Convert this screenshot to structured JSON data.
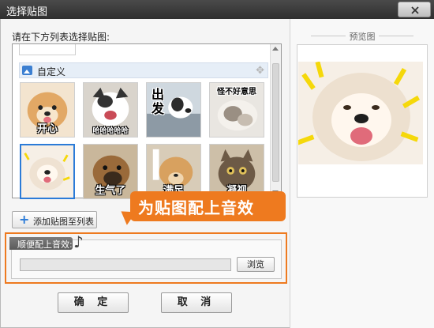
{
  "window": {
    "title": "选择贴图",
    "close_icon": "close-x-icon"
  },
  "left": {
    "choose_label": "请在下方列表选择贴图:",
    "section": {
      "label": "自定义",
      "icon": "picture-icon",
      "move_icon": "move-arrows-icon"
    },
    "stickers": [
      {
        "caption": "开心"
      },
      {
        "caption": "哈哈哈哈哈"
      },
      {
        "caption": "出发"
      },
      {
        "caption": "怪不好意思"
      },
      {
        "caption": ""
      },
      {
        "caption": "生气了"
      },
      {
        "caption": "满足"
      },
      {
        "caption": "凝视"
      }
    ],
    "add_button": "添加贴图至列表",
    "add_icon": "plus-icon"
  },
  "callout": {
    "text": "为贴图配上音效",
    "color": "#EE7A1F"
  },
  "sound": {
    "label": "顺便配上音效:",
    "icon": "music-note-icon",
    "path_value": "",
    "browse_label": "浏览"
  },
  "buttons": {
    "ok": "确 定",
    "cancel": "取 消"
  },
  "preview": {
    "title": "预览图"
  }
}
